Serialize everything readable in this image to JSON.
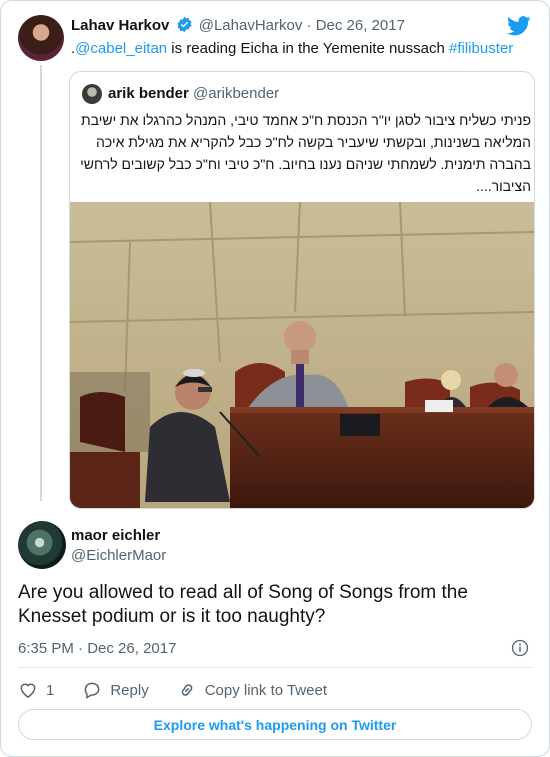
{
  "tweet": {
    "author_name": "Lahav Harkov",
    "author_handle": "@LahavHarkov",
    "date_sep": " · ",
    "date": "Dec 26, 2017",
    "text_prefix": ".",
    "mention": "@cabel_eitan",
    "text_middle": " is reading Eicha in the Yemenite nussach ",
    "hashtag": "#filibuster"
  },
  "quoted": {
    "author_name": "arik bender",
    "author_handle": "@arikbender",
    "text": "פניתי כשליח ציבור לסגן יו\"ר הכנסת ח\"כ אחמד טיבי, המנהל כהרגלו את ישיבת המליאה בשנינות, ובקשתי שיעביר בקשה לח\"כ כבל להקריא את מגילת איכה בהברה תימנית. לשמחתי שניהם נענו בחיוב. ח\"כ טיבי וח\"כ כבל קשובים לרחשי הציבור...."
  },
  "reply": {
    "author_name": "maor eichler",
    "author_handle": "@EichlerMaor",
    "text": "Are you allowed to read all of Song of Songs from the Knesset podium or is it too naughty?",
    "time": "6:35 PM",
    "date_sep": " · ",
    "date": "Dec 26, 2017"
  },
  "actions": {
    "like_count": "1",
    "reply_label": "Reply",
    "copy_label": "Copy link to Tweet"
  },
  "explore_label": "Explore what's happening on Twitter",
  "colors": {
    "accent": "#1d9bf0",
    "muted": "#536471",
    "border": "#cfd9de",
    "verified": "#1d9bf0"
  }
}
